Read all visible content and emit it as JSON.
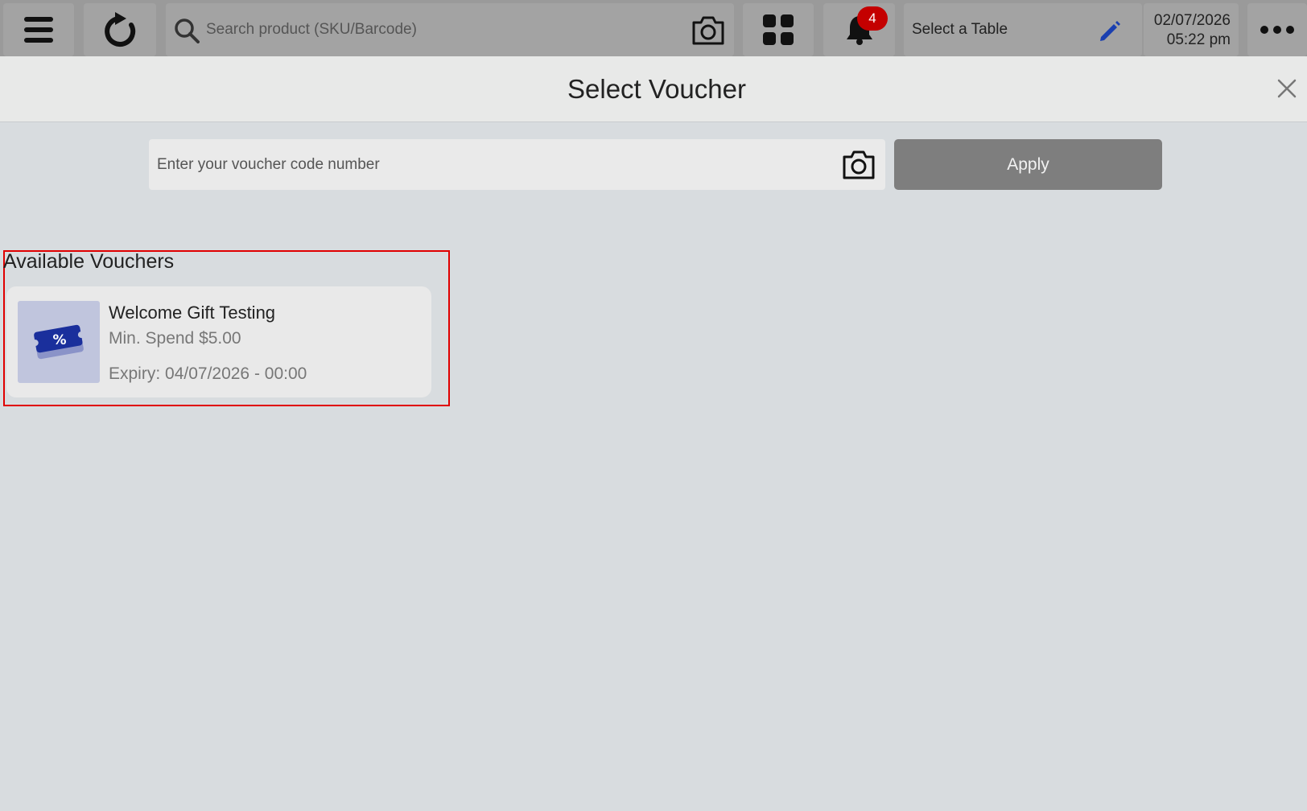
{
  "topbar": {
    "search_placeholder": "Search product (SKU/Barcode)",
    "notification_count": "4",
    "table_label": "Select a Table",
    "date": "02/07/2026",
    "time": "05:22 pm",
    "icons": [
      "menu-icon",
      "refresh-icon",
      "search-icon",
      "camera-icon",
      "grid-icon",
      "bell-icon",
      "pencil-icon",
      "more-icon"
    ]
  },
  "modal": {
    "title": "Select Voucher",
    "voucher_input_placeholder": "Enter your voucher code number",
    "apply_label": "Apply",
    "section_title": "Available Vouchers",
    "vouchers": [
      {
        "name": "Welcome Gift Testing",
        "min_spend": "Min. Spend $5.00",
        "expiry": "Expiry: 04/07/2026 - 00:00",
        "icon_symbol": "%"
      }
    ]
  },
  "colors": {
    "accent_blue": "#1a2f9c",
    "badge_red": "#c40000",
    "highlight_border": "#e00000"
  }
}
